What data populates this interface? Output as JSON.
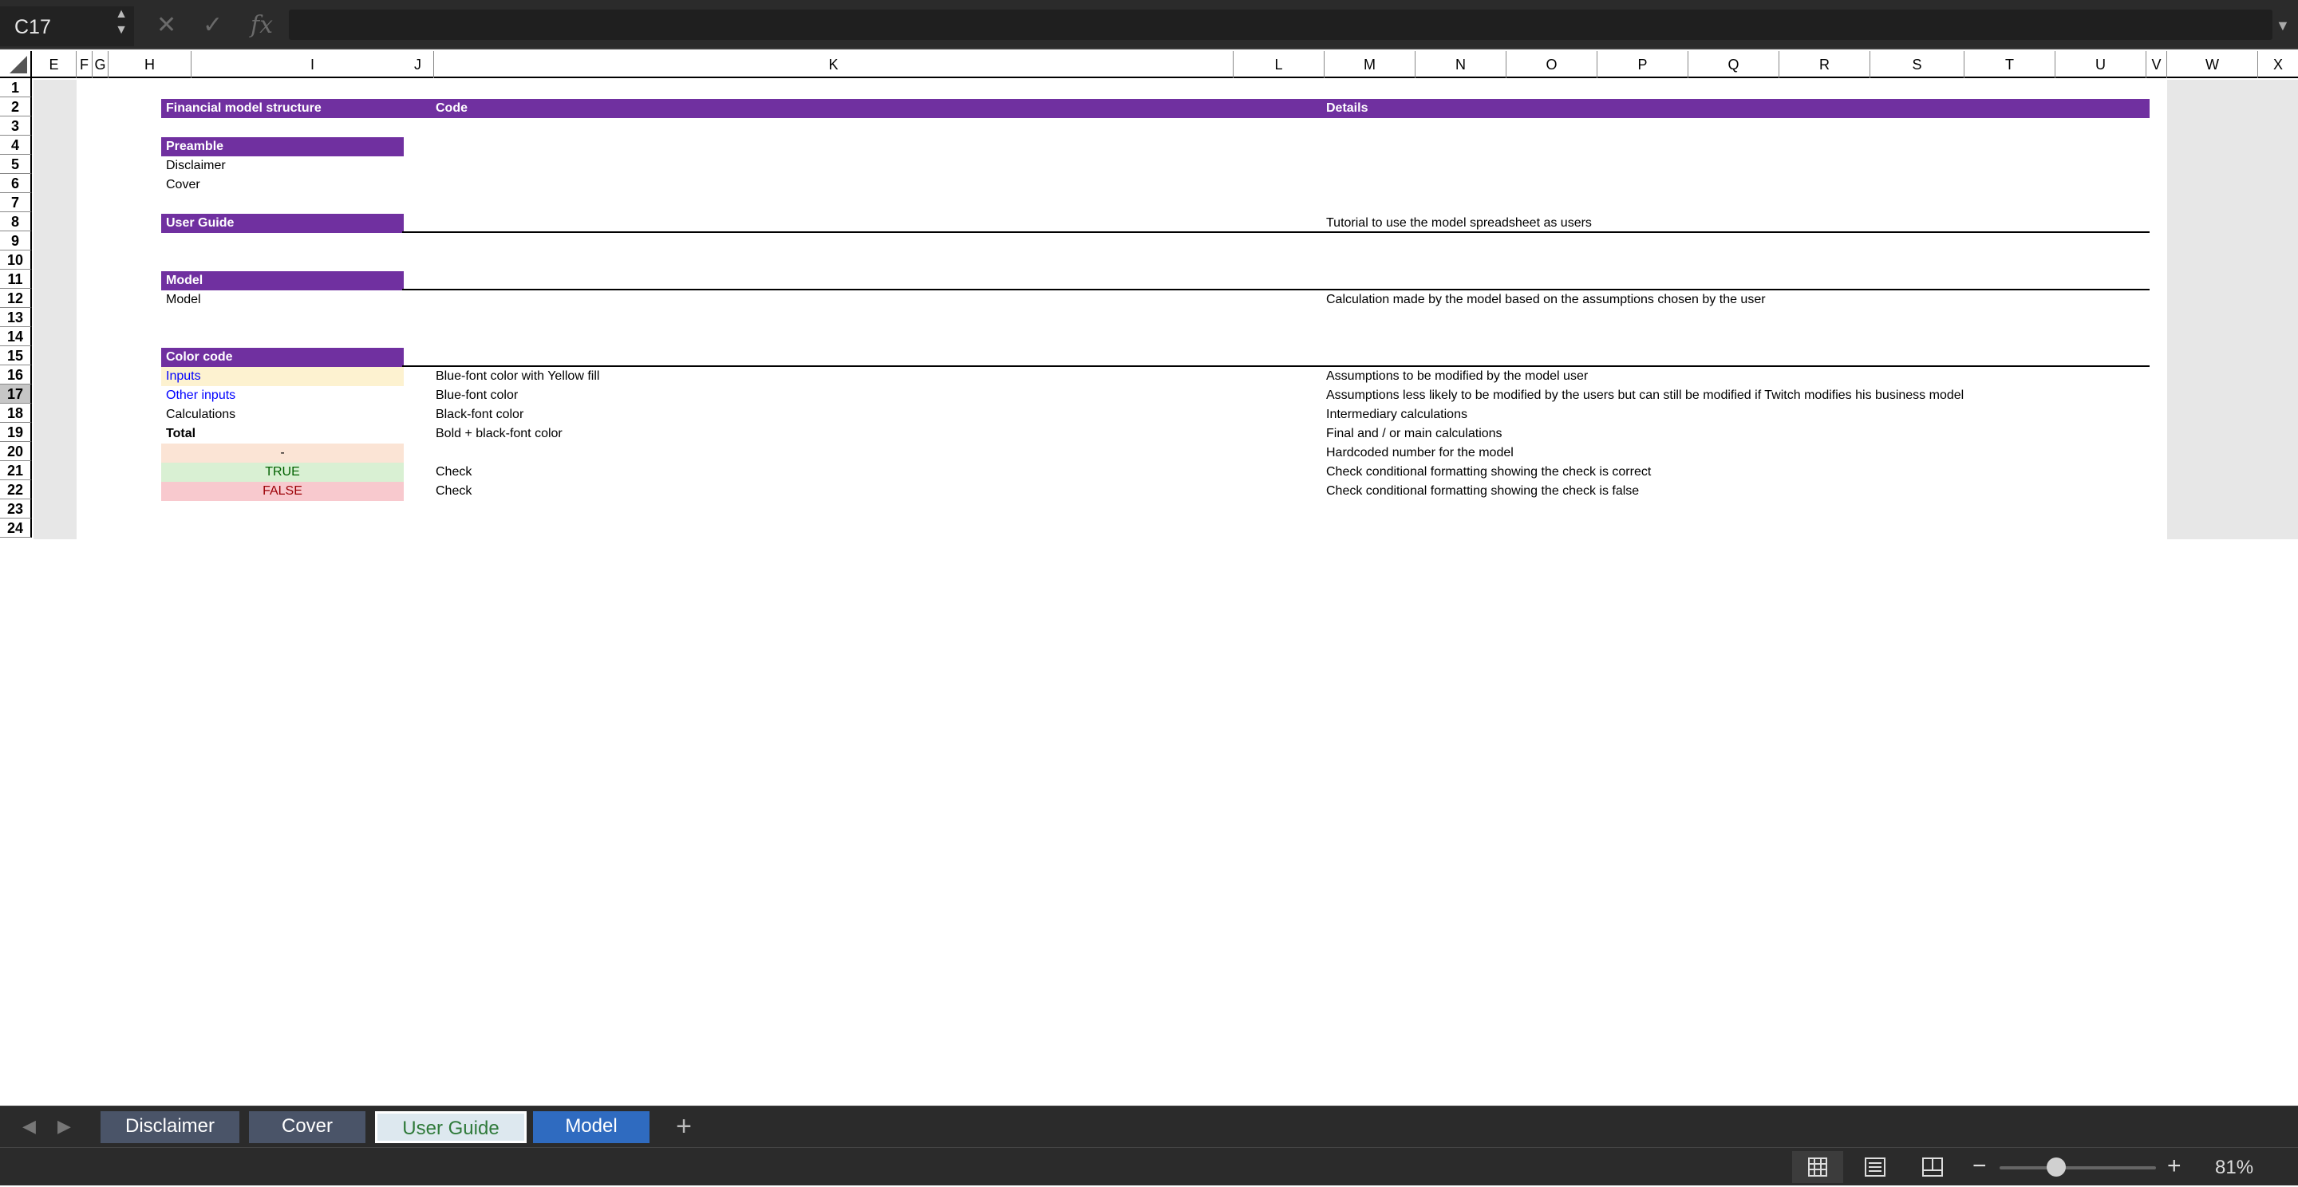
{
  "formula_bar": {
    "cell_reference": "C17",
    "formula_value": ""
  },
  "columns": [
    "E",
    "F",
    "G",
    "H",
    "I",
    "J",
    "K",
    "L",
    "M",
    "N",
    "O",
    "P",
    "Q",
    "R",
    "S",
    "T",
    "U",
    "V",
    "W",
    "X"
  ],
  "rows": [
    "1",
    "2",
    "3",
    "4",
    "5",
    "6",
    "7",
    "8",
    "9",
    "10",
    "11",
    "12",
    "13",
    "14",
    "15",
    "16",
    "17",
    "18",
    "19",
    "20",
    "21",
    "22",
    "23",
    "24"
  ],
  "cells": {
    "header_structure": "Financial model structure",
    "header_code": "Code",
    "header_details": "Details",
    "preamble": "Preamble",
    "disclaimer": "Disclaimer",
    "cover": "Cover",
    "user_guide": "User Guide",
    "user_guide_details": "Tutorial to use the model spreadsheet as users",
    "model_section": "Model",
    "model_item": "Model",
    "model_details": "Calculation made by the model based on the assumptions chosen by the user",
    "color_code": "Color code",
    "inputs": "Inputs",
    "inputs_code": "Blue-font color with Yellow fill",
    "inputs_details": "Assumptions to be modified by the model user",
    "other_inputs": "Other inputs",
    "other_inputs_code": "Blue-font color",
    "other_inputs_details": "Assumptions less likely to be modified by the users but can still be modified if Twitch modifies his business model",
    "calculations": "Calculations",
    "calculations_code": "Black-font color",
    "calculations_details": "Intermediary calculations",
    "total": "Total",
    "total_code": "Bold + black-font color",
    "total_details": "Final  and / or main calculations",
    "hardcoded": "-",
    "hardcoded_details": "Hardcoded number for the model",
    "true_value": "TRUE",
    "true_code": "Check",
    "true_details": "Check conditional formatting showing the check is correct",
    "false_value": "FALSE",
    "false_code": "Check",
    "false_details": "Check conditional formatting showing the check is false"
  },
  "sheet_tabs": [
    "Disclaimer",
    "Cover",
    "User Guide",
    "Model"
  ],
  "active_sheet": "User Guide",
  "status_bar": {
    "zoom_level": "81%",
    "zoom_fraction": 0.36
  },
  "colors": {
    "header_purple": "#7030a0",
    "input_fill": "#fdf2d0",
    "input_font": "#0000ff",
    "hardcoded_fill": "#fbe4d5",
    "true_fill": "#d9f0d3",
    "true_font": "#006100",
    "false_fill": "#f8c9ce",
    "false_font": "#9c0006"
  }
}
